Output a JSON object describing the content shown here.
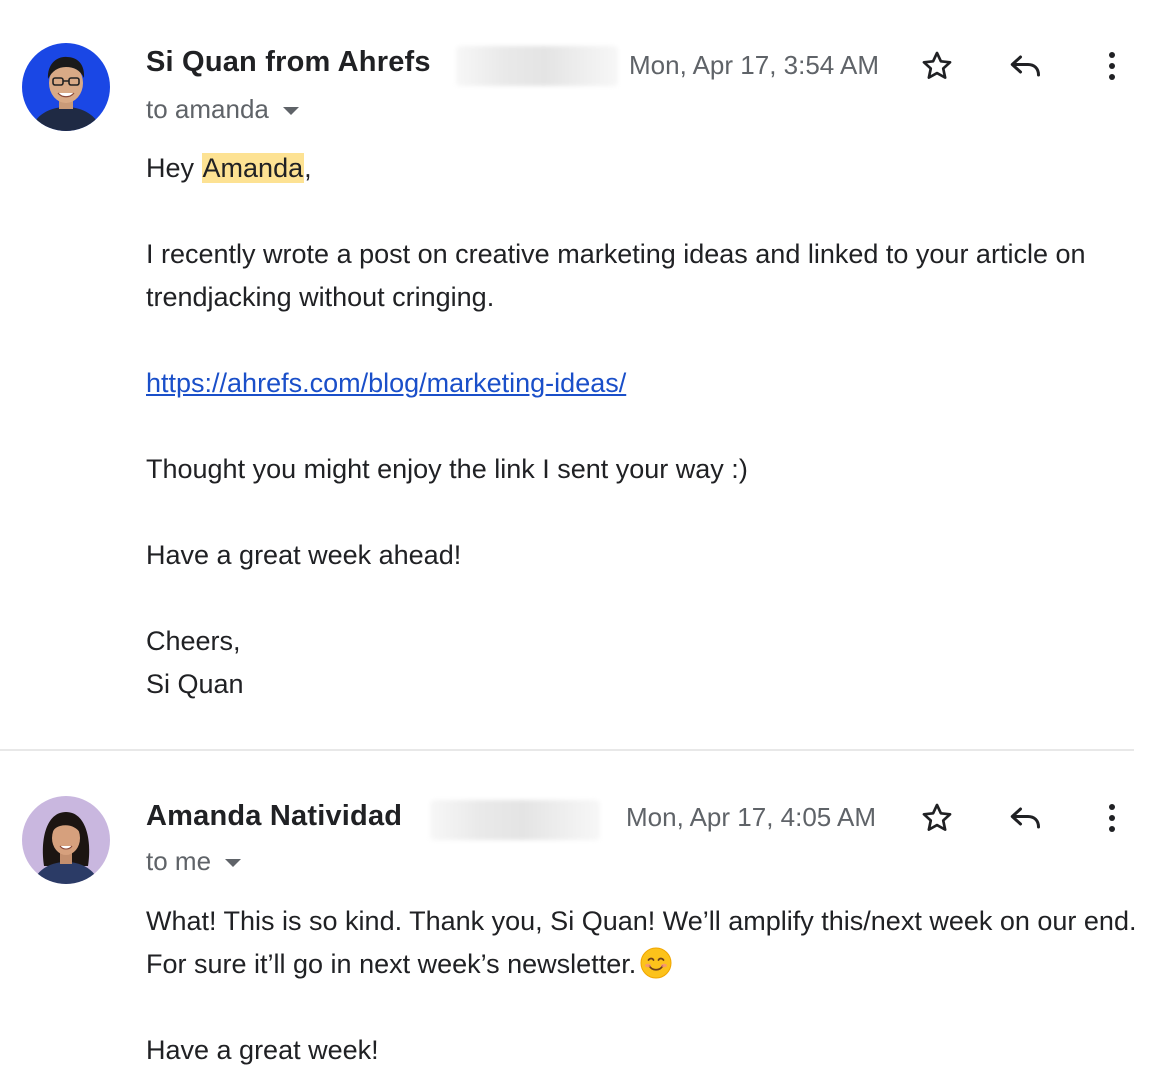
{
  "messages": [
    {
      "sender": "Si Quan from Ahrefs",
      "timestamp": "Mon, Apr 17, 3:54 AM",
      "recipient": "to amanda",
      "greeting_prefix": "Hey ",
      "greeting_name": "Amanda",
      "greeting_suffix": ",",
      "paragraph_1": "I recently wrote a post on creative marketing ideas and linked to your article on trendjacking without cringing.",
      "link": "https://ahrefs.com/blog/marketing-ideas/",
      "paragraph_2": "Thought you might enjoy the link I sent your way :)",
      "paragraph_3": "Have a great week ahead!",
      "signoff_line_1": "Cheers,",
      "signoff_line_2": "Si Quan",
      "avatar_icon": "avatar-photo-man",
      "avatar_bg": "#1a47e5"
    },
    {
      "sender": "Amanda Natividad",
      "timestamp": "Mon, Apr 17, 4:05 AM",
      "recipient": "to me",
      "paragraph_1": "What! This is so kind. Thank you, Si Quan! We’ll amplify this/next week on our end. For sure it’ll go in next week’s newsletter.",
      "emoji_icon": "smiling-face-emoji",
      "paragraph_2": "Have a great week!",
      "avatar_icon": "avatar-photo-woman",
      "avatar_bg": "#c9b7df"
    }
  ],
  "icons": {
    "star": "star-outline-icon",
    "reply": "reply-arrow-icon",
    "more": "more-vertical-icon",
    "caret": "caret-down-icon"
  },
  "colors": {
    "highlight": "#fde293",
    "link": "#1a4fc9",
    "meta_text": "#5f6368",
    "divider": "#e8e8e8"
  }
}
